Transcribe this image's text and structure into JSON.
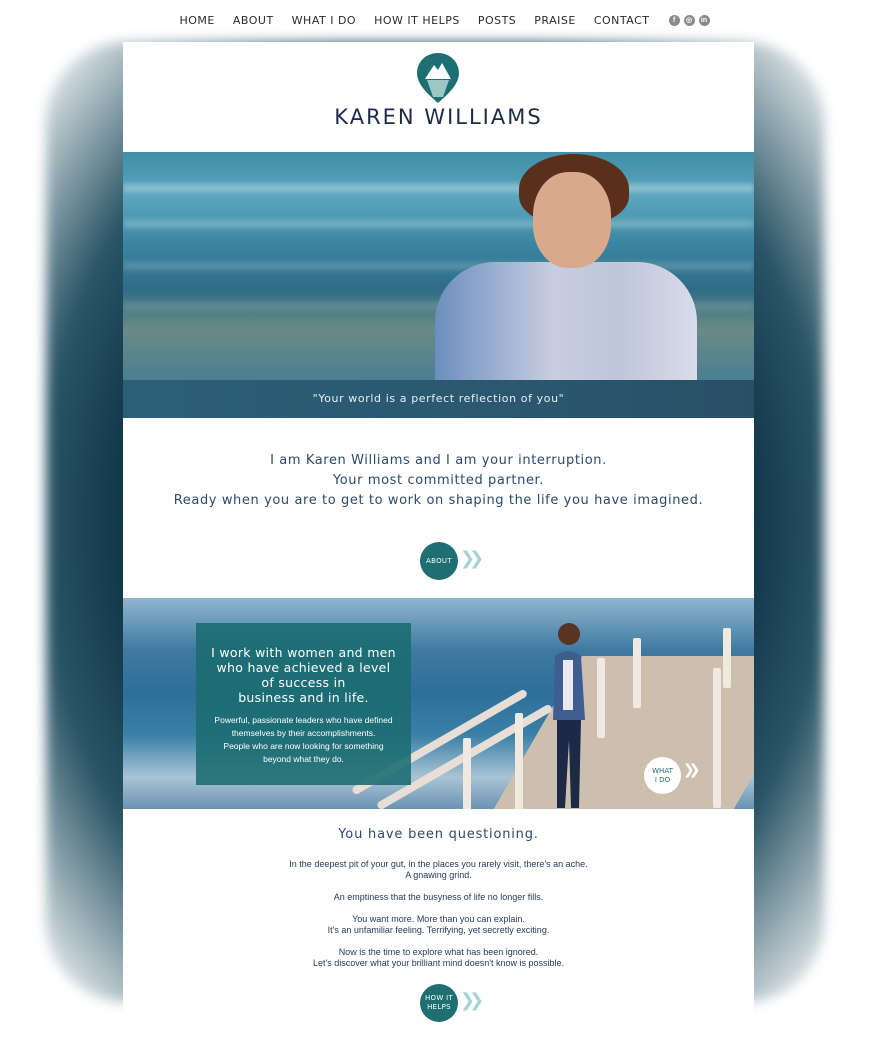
{
  "nav": {
    "items": [
      "HOME",
      "ABOUT",
      "WHAT I DO",
      "HOW IT HELPS",
      "POSTS",
      "PRAISE",
      "CONTACT"
    ],
    "socials": [
      {
        "icon": "facebook-icon",
        "glyph": "f"
      },
      {
        "icon": "instagram-icon",
        "glyph": "◎"
      },
      {
        "icon": "linkedin-icon",
        "glyph": "in"
      }
    ]
  },
  "header": {
    "brand": "KAREN WILLIAMS"
  },
  "hero": {
    "quote": "\"Your world is a perfect reflection of you\""
  },
  "intro": {
    "lines": [
      "I am Karen Williams and I am your interruption.",
      "Your most committed partner.",
      "Ready when you are to get to work on shaping the life you have imagined."
    ],
    "button": "ABOUT"
  },
  "work": {
    "lead": [
      "I work with women and men",
      "who have achieved a level",
      "of success in",
      "business and in life."
    ],
    "sub": [
      "Powerful, passionate leaders who have defined",
      "themselves by their accomplishments.",
      "People who are now looking for something",
      "beyond what they do."
    ],
    "button_lines": [
      "WHAT",
      "I DO"
    ]
  },
  "questioning": {
    "heading": "You have been questioning.",
    "paragraphs": [
      [
        "In the deepest pit of your gut, in the places you rarely visit, there's an ache.",
        "A gnawing grind."
      ],
      [
        "An emptiness that the busyness of life no longer fills."
      ],
      [
        "You want more.  More than you can explain.",
        "It's an unfamiliar feeling. Terrifying, yet secretly exciting."
      ],
      [
        "Now is the time to explore what has been ignored.",
        "Let's discover what your brilliant mind doesn't know is possible."
      ]
    ],
    "button_lines": [
      "HOW IT",
      "HELPS"
    ]
  },
  "colors": {
    "teal": "#1f6e72",
    "navy_text": "#2b4a6b",
    "quote_bar": "#2b5f78"
  }
}
